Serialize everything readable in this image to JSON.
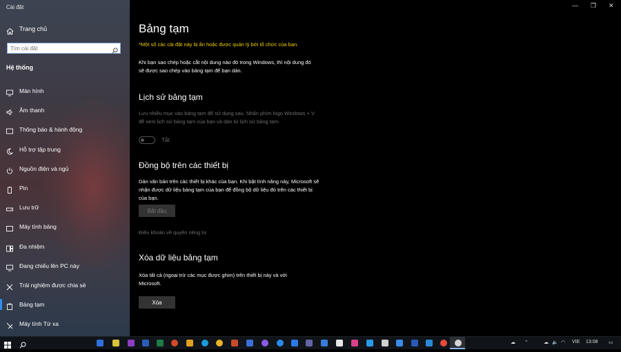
{
  "window": {
    "app_title": "Cài đặt",
    "controls": [
      "—",
      "❐",
      "✕"
    ]
  },
  "sidebar": {
    "home_label": "Trang chủ",
    "search_placeholder": "Tìm cài đặt",
    "section_title": "Hệ thống",
    "items": [
      {
        "label": "Màn hình",
        "icon": "monitor-icon"
      },
      {
        "label": "Âm thanh",
        "icon": "speaker-icon"
      },
      {
        "label": "Thông báo & hành động",
        "icon": "notification-icon"
      },
      {
        "label": "Hỗ trợ tập trung",
        "icon": "moon-icon"
      },
      {
        "label": "Nguồn điện và ngủ",
        "icon": "power-icon"
      },
      {
        "label": "Pin",
        "icon": "battery-icon"
      },
      {
        "label": "Lưu trữ",
        "icon": "storage-icon"
      },
      {
        "label": "Máy tính bảng",
        "icon": "tablet-icon"
      },
      {
        "label": "Đa nhiệm",
        "icon": "multitask-icon"
      },
      {
        "label": "Đang chiếu lên PC này",
        "icon": "project-icon"
      },
      {
        "label": "Trải nghiệm được chia sẻ",
        "icon": "share-icon"
      },
      {
        "label": "Bảng tạm",
        "icon": "clipboard-icon",
        "active": true
      },
      {
        "label": "Máy tính Từ xa",
        "icon": "remote-icon"
      }
    ]
  },
  "main": {
    "title": "Bảng tạm",
    "warning": "*Một số các cài đặt này bị ẩn hoặc được quản lý bởi tổ chức của bạn.",
    "intro": "Khi bạn sao chép hoặc cắt nội dung nào đó trong Windows, thì nội dung đó sẽ được sao chép vào bảng tạm để bạn dán.",
    "history": {
      "heading": "Lịch sử bảng tạm",
      "description": "Lưu nhiều mục vào bảng tạm để sử dụng sau. Nhấn phím logo Windows + V để xem lịch sử bảng tạm của bạn và dán từ lịch sử bảng tạm.",
      "toggle_state": "Tắt"
    },
    "sync": {
      "heading": "Đồng bộ trên các thiết bị",
      "description": "Dán văn bản trên các thiết bị khác của bạn. Khi bật tính năng này, Microsoft sẽ nhận được dữ liệu bảng tạm của bạn để đồng bộ dữ liệu đó trên các thiết bị của bạn.",
      "button": "Bắt đầu",
      "privacy_link": "Điều khoản về quyền riêng tư"
    },
    "clear": {
      "heading": "Xóa dữ liệu bảng tạm",
      "description": "Xóa tất cả (ngoại trừ các mục được ghim) trên thiết bị này và với Microsoft.",
      "button": "Xóa"
    }
  },
  "taskbar": {
    "language": "VIE",
    "time": "13:08",
    "apps": [
      {
        "name": "start-icon",
        "color": "#ffffff"
      },
      {
        "name": "search-icon",
        "color": "#ffffff"
      },
      {
        "name": "app-icon",
        "color": "#2f6fd8"
      },
      {
        "name": "app-icon",
        "color": "#d8c23a"
      },
      {
        "name": "onenote-icon",
        "color": "#8a3fc0"
      },
      {
        "name": "word-icon",
        "color": "#2b5cb8"
      },
      {
        "name": "excel-icon",
        "color": "#1e7b45"
      },
      {
        "name": "powerpoint-icon",
        "color": "#d04a2b"
      },
      {
        "name": "app-icon",
        "color": "#e0a020"
      },
      {
        "name": "edge-icon",
        "color": "#1e9bd8"
      },
      {
        "name": "chrome-icon",
        "color": "#e8b22a"
      },
      {
        "name": "app-icon",
        "color": "#c84a2a"
      },
      {
        "name": "facebook-icon",
        "color": "#3b6fd8"
      },
      {
        "name": "messenger-icon",
        "color": "#8a5ae8"
      },
      {
        "name": "zalo-icon",
        "color": "#2a8ae8"
      },
      {
        "name": "zoom-icon",
        "color": "#2a7ae8"
      },
      {
        "name": "teams-icon",
        "color": "#6264a7"
      },
      {
        "name": "app-icon",
        "color": "#3a7ad8"
      },
      {
        "name": "tiktok-icon",
        "color": "#e8e8e8"
      },
      {
        "name": "instagram-icon",
        "color": "#d8408a"
      },
      {
        "name": "app-icon",
        "color": "#2a9ae8"
      },
      {
        "name": "app-icon",
        "color": "#d0d0d0"
      },
      {
        "name": "app-icon",
        "color": "#3a8ae8"
      },
      {
        "name": "photoshop-icon",
        "color": "#2a5ab8"
      },
      {
        "name": "app-icon",
        "color": "#2a8ad8"
      },
      {
        "name": "chrome-icon",
        "color": "#e84a3a"
      },
      {
        "name": "settings-icon",
        "color": "#d0d0d0"
      }
    ]
  }
}
